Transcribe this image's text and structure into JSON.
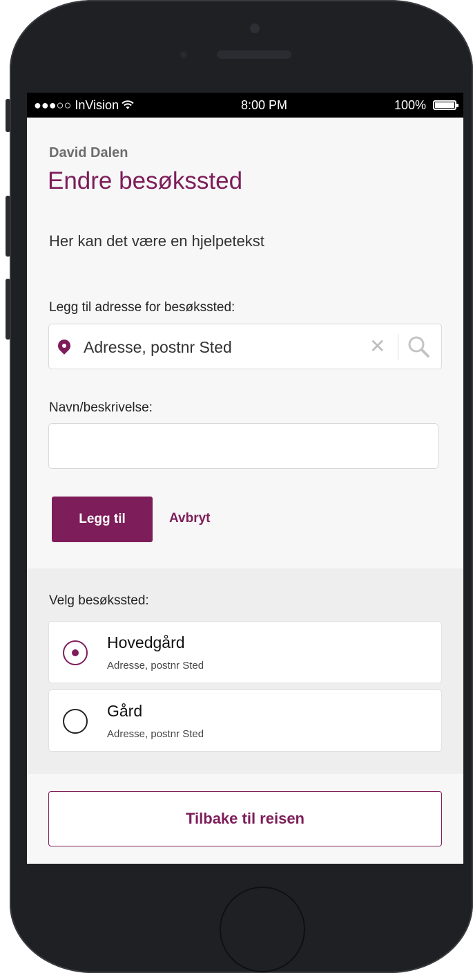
{
  "status_bar": {
    "carrier": "●●●○○ InVision",
    "wifi_icon": "wifi-icon",
    "time": "8:00 PM",
    "battery": "100%",
    "battery_level": 1.0
  },
  "header": {
    "user_name": "David Dalen",
    "title": "Endre besøkssted",
    "help_text": "Her kan det være en hjelpetekst"
  },
  "address_field": {
    "label": "Legg til adresse for besøkssted:",
    "placeholder": "Adresse, postnr Sted",
    "value": ""
  },
  "name_field": {
    "label": "Navn/beskrivelse:",
    "value": ""
  },
  "actions": {
    "add_label": "Legg til",
    "cancel_label": "Avbryt"
  },
  "visit_places": {
    "label": "Velg besøkssted:",
    "items": [
      {
        "name": "Hovedgård",
        "address": "Adresse, postnr Sted",
        "selected": true
      },
      {
        "name": "Gård",
        "address": "Adresse, postnr Sted",
        "selected": false
      }
    ]
  },
  "back_button": "Tilbake til reisen",
  "colors": {
    "accent": "#7d1d59",
    "background": "#f7f7f7",
    "section_background": "#eeeeee"
  }
}
